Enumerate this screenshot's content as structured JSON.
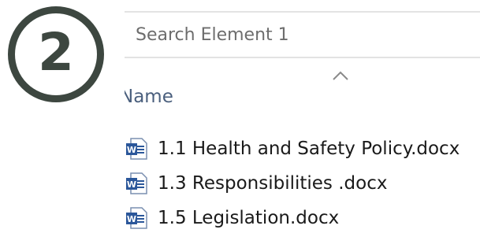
{
  "step_badge": {
    "number": "2"
  },
  "search": {
    "placeholder": "Search Element 1",
    "value": ""
  },
  "column_header": {
    "name": "Name",
    "sort_icon": "chevron-up-icon"
  },
  "files": [
    {
      "name": "1.1 Health and Safety Policy.docx",
      "icon": "word-document-icon"
    },
    {
      "name": "1.3 Responsibilities .docx",
      "icon": "word-document-icon"
    },
    {
      "name": "1.5 Legislation.docx",
      "icon": "word-document-icon"
    }
  ],
  "colors": {
    "badge": "#3d4740",
    "header_text": "#4a5f7d",
    "word_blue": "#2b579a"
  }
}
